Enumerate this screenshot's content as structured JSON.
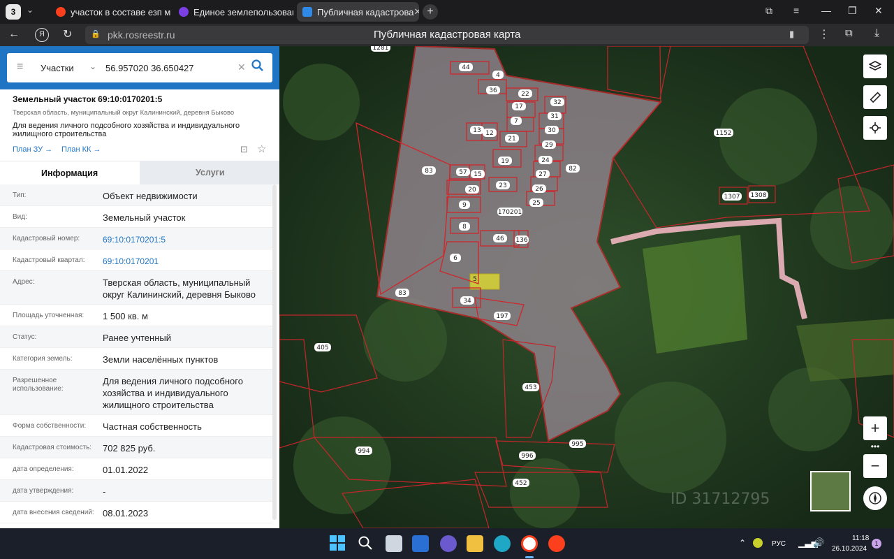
{
  "browser": {
    "tabs": [
      {
        "label": "участок в составе езп мо",
        "icon_color": "#fc3f1d"
      },
      {
        "label": "Единое землепользовани",
        "icon_color": "#7b3fe4"
      },
      {
        "label": "Публичная кадастрова",
        "icon_color": "#2e8ae6"
      }
    ],
    "tab_counter": "3",
    "url": "pkk.rosreestr.ru",
    "page_title": "Публичная кадастровая карта"
  },
  "search": {
    "type_label": "Участки",
    "query": "56.957020 36.650427"
  },
  "parcel": {
    "title": "Земельный участок 69:10:0170201:5",
    "address_small": "Тверская область, муниципальный округ Калининский, деревня Быково",
    "purpose": "Для ведения личного подсобного хозяйства и индивидуального жилищного строительства",
    "link_plan_zu": "План ЗУ →",
    "link_plan_kk": "План КК →"
  },
  "info_tabs": {
    "info": "Информация",
    "services": "Услуги"
  },
  "attributes": [
    {
      "key": "Тип:",
      "value": "Объект недвижимости"
    },
    {
      "key": "Вид:",
      "value": "Земельный участок"
    },
    {
      "key": "Кадастровый номер:",
      "value": "69:10:0170201:5"
    },
    {
      "key": "Кадастровый квартал:",
      "value": "69:10:0170201"
    },
    {
      "key": "Адрес:",
      "value": "Тверская область, муниципальный округ Калининский, деревня Быково"
    },
    {
      "key": "Площадь уточненная:",
      "value": "1 500 кв. м"
    },
    {
      "key": "Статус:",
      "value": "Ранее учтенный"
    },
    {
      "key": "Категория земель:",
      "value": "Земли населённых пунктов"
    },
    {
      "key": "Разрешенное использование:",
      "value": "Для ведения личного подсобного хозяйства и индивидуального жилищного строительства"
    },
    {
      "key": "Форма собственности:",
      "value": "Частная собственность"
    },
    {
      "key": "Кадастровая стоимость:",
      "value": "702 825 руб."
    },
    {
      "key": "дата определения:",
      "value": "01.01.2022"
    },
    {
      "key": "дата утверждения:",
      "value": "-"
    },
    {
      "key": "дата внесения сведений:",
      "value": "08.01.2023"
    }
  ],
  "map": {
    "parcel_labels": [
      "44",
      "4",
      "36",
      "22",
      "32",
      "17",
      "31",
      "7",
      "30",
      "13",
      "12",
      "21",
      "29",
      "19",
      "24",
      "57",
      "15",
      "82",
      "83",
      "20",
      "23",
      "27",
      "26",
      "9",
      "25",
      "170201",
      "8",
      "46",
      "136",
      "6",
      "5",
      "83",
      "34",
      "197",
      "1152",
      "1307",
      "1308",
      "405",
      "453",
      "994",
      "995",
      "996",
      "452",
      "1281"
    ],
    "watermark": "ID 31712795"
  },
  "taskbar": {
    "lang": "РУС",
    "time": "11:18",
    "date": "26.10.2024",
    "notifications": "1"
  }
}
